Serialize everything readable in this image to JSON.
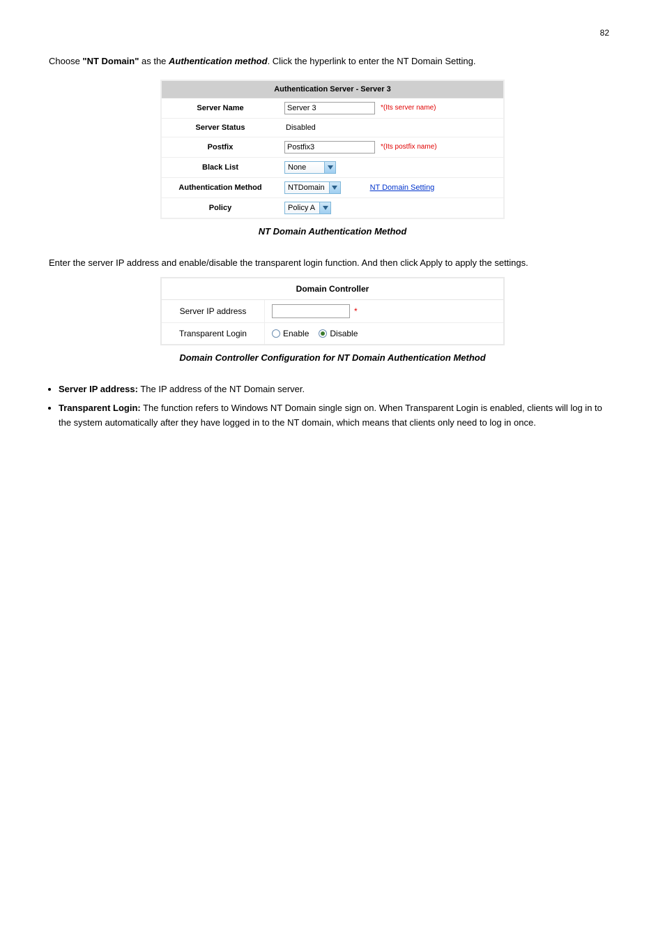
{
  "page_number": "82",
  "intro_prefix": "Choose ",
  "intro_bold": "\"NT Domain\"",
  "intro_mid": " as the ",
  "intro_italic": "Authentication method",
  "intro_suffix": ". Click the hyperlink to enter the NT Domain Setting.",
  "auth_panel": {
    "title": "Authentication Server - Server 3",
    "rows": {
      "server_name": {
        "label": "Server Name",
        "value": "Server 3",
        "hint": "*(Its server name)"
      },
      "server_status": {
        "label": "Server Status",
        "value": "Disabled"
      },
      "postfix": {
        "label": "Postfix",
        "value": "Postfix3",
        "hint": "*(Its postfix name)"
      },
      "black_list": {
        "label": "Black List",
        "value": "None"
      },
      "auth_method": {
        "label": "Authentication Method",
        "value": "NTDomain",
        "link": "NT Domain Setting"
      },
      "policy": {
        "label": "Policy",
        "value": "Policy A"
      }
    }
  },
  "caption1": "NT Domain Authentication Method",
  "paragraph": "Enter the server IP address and enable/disable the transparent login function. And then click Apply to apply the settings.",
  "dc_panel": {
    "title": "Domain Controller",
    "server_ip_label": "Server IP address",
    "transparent_login_label": "Transparent Login",
    "enable_label": "Enable",
    "disable_label": "Disable",
    "selected": "disable"
  },
  "caption2": "Domain Controller Configuration for NT Domain Authentication Method",
  "bullets": {
    "b1_bold": "Server IP address:",
    "b1_text": " The IP address of the NT Domain server.",
    "b2_bold": "Transparent Login:",
    "b2_text": " The function refers to Windows NT Domain single sign on. When Transparent Login is enabled, clients will log in to the system automatically after they have logged in to the NT domain, which means that clients only need to log in once."
  }
}
